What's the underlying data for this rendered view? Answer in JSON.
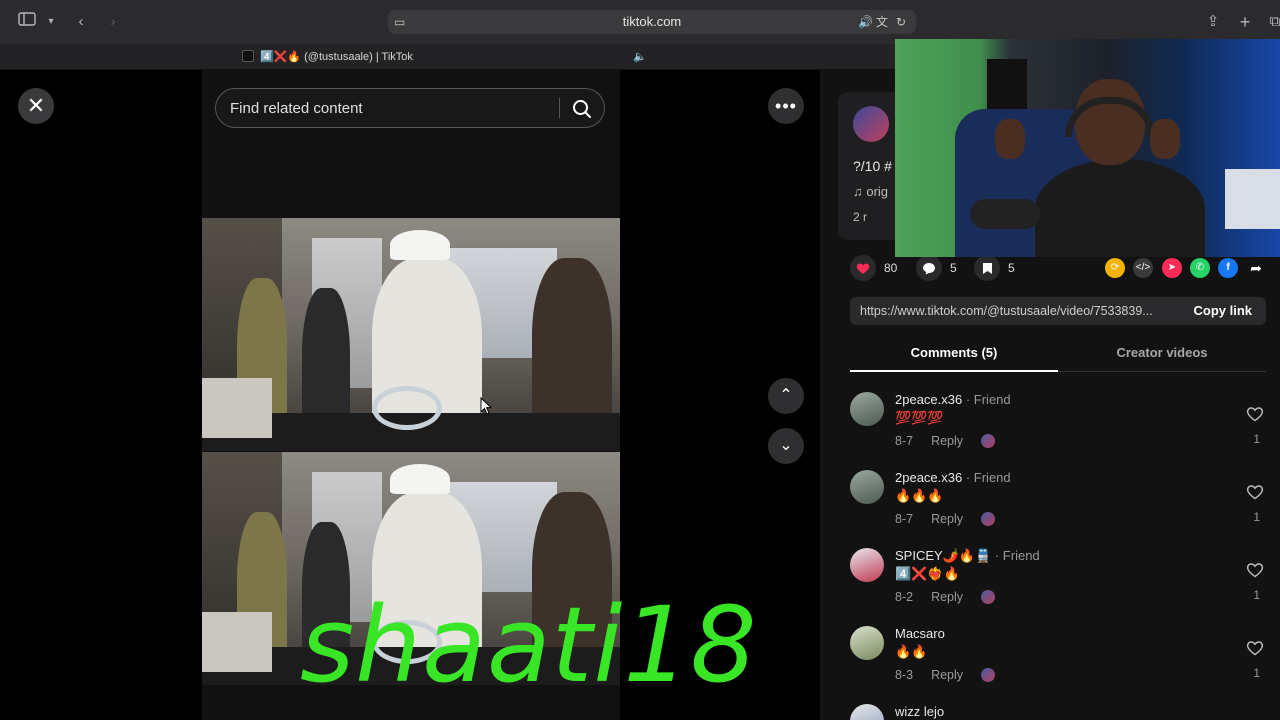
{
  "browser": {
    "url": "tiktok.com",
    "tab_title": "4️⃣❌🔥 (@tustusaale) | TikTok"
  },
  "search": {
    "placeholder": "Find related content"
  },
  "post": {
    "description": "?/10 #",
    "music": "♫  orig",
    "friends_prefix": "2 r",
    "likes": "80",
    "comments_count": "5",
    "saves": "5"
  },
  "link": {
    "url": "https://www.tiktok.com/@tustusaale/video/7533839...",
    "copy_label": "Copy link"
  },
  "tabs": [
    {
      "label": "Comments (5)"
    },
    {
      "label": "Creator videos"
    }
  ],
  "comments": [
    {
      "name": "2peace.x36",
      "relation": " · Friend",
      "text": "💯💯💯",
      "date": "8-7",
      "reply": "Reply",
      "likes": "1"
    },
    {
      "name": "2peace.x36",
      "relation": " · Friend",
      "text": "🔥🔥🔥",
      "date": "8-7",
      "reply": "Reply",
      "likes": "1"
    },
    {
      "name": "SPICEY🌶️🔥🚆",
      "relation": " · Friend",
      "text": "4️⃣❌❤️‍🔥🔥",
      "date": "8-2",
      "reply": "Reply",
      "likes": "1"
    },
    {
      "name": "Macsaro",
      "relation": "",
      "text": "🔥🔥",
      "date": "8-3",
      "reply": "Reply",
      "likes": "1"
    },
    {
      "name": "wizz lejo",
      "relation": "",
      "text": "",
      "date": "",
      "reply": "",
      "likes": ""
    }
  ],
  "overlay": {
    "watermark": "shaati18"
  },
  "colors": {
    "heart": "#fe2c55",
    "watermark": "#39e626",
    "share_orange": "#f4b400",
    "share_red": "#fe2c55",
    "whatsapp": "#25d366",
    "facebook": "#1877f2"
  }
}
